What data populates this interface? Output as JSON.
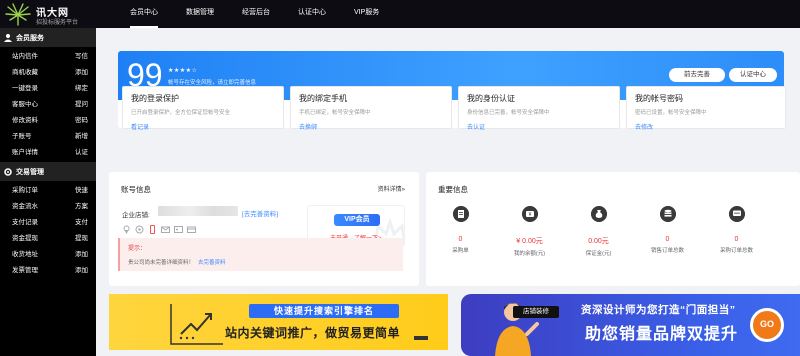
{
  "brand": {
    "name": "讯大网",
    "sub": "招投标服务平台"
  },
  "topnav": [
    "会员中心",
    "数据管理",
    "经营后台",
    "认证中心",
    "VIP服务"
  ],
  "sidebar": {
    "member_title": "会员服务",
    "member_rows": [
      [
        "站内信件",
        "写信"
      ],
      [
        "商机收藏",
        "添加"
      ],
      [
        "一键登录",
        "绑定"
      ],
      [
        "客服中心",
        "提问"
      ],
      [
        "修改资料",
        "密码"
      ],
      [
        "子账号",
        "新增"
      ],
      [
        "账户详情",
        "认证"
      ]
    ],
    "trade_title": "交易管理",
    "trade_rows": [
      [
        "采购订单",
        "快速"
      ],
      [
        "资金流水",
        "方案"
      ],
      [
        "支付记录",
        "支付"
      ],
      [
        "资金提现",
        "提现"
      ],
      [
        "收货地址",
        "添加"
      ],
      [
        "发票管理",
        "添加"
      ]
    ]
  },
  "score": {
    "value": "99",
    "stars": "★★★★☆",
    "text": "帐号存在安全风险，请立即完善信息",
    "btn_complete": "前去完善",
    "btn_verify": "认证中心"
  },
  "security": [
    {
      "title": "我的登录保护",
      "desc": "已开启登录保护，全方位保证您帐号安全",
      "link": "看记录"
    },
    {
      "title": "我的绑定手机",
      "desc": "手机已绑定，帐号安全保障中",
      "link": "去换绑"
    },
    {
      "title": "我的身份认证",
      "desc": "身份信息已完善，帐号安全保障中",
      "link": "去认证"
    },
    {
      "title": "我的帐号密码",
      "desc": "密码已设置，帐号安全保障中",
      "link": "去修改"
    }
  ],
  "account": {
    "title": "账号信息",
    "detail_link": "资料详情»",
    "company_label": "企业店铺:",
    "complete_link": "[去完善资料]",
    "vip_tag": "VIP会员",
    "vip_sub": "未开通，了解一下>",
    "tip_title": "提示：",
    "tip_body": "贵公司尚未完善详细资料！",
    "tip_link": "去完善资料"
  },
  "important": {
    "title": "重要信息",
    "stats": [
      {
        "value": "0",
        "label": "采购单"
      },
      {
        "value": "¥ 0.00元",
        "label": "我的余额(元)"
      },
      {
        "value": "0.00元",
        "label": "保证金(元)"
      },
      {
        "value": "0",
        "label": "销售订单总数"
      },
      {
        "value": "0",
        "label": "采购订单总数"
      }
    ]
  },
  "banners": {
    "left_title": "快速提升搜索引擎排名",
    "left_sub": "站内关键词推广，做贸易更简单",
    "right_tag": "店铺装修",
    "right_line1": "资深设计师为您打造“门面担当”",
    "right_line2": "助您销量品牌双提升",
    "right_go": "GO"
  },
  "colors": {
    "accent": "#1f80f5",
    "link": "#3c8aff",
    "danger": "#e33333",
    "sidebar": "#000000",
    "topbar": "#0c0c12"
  }
}
